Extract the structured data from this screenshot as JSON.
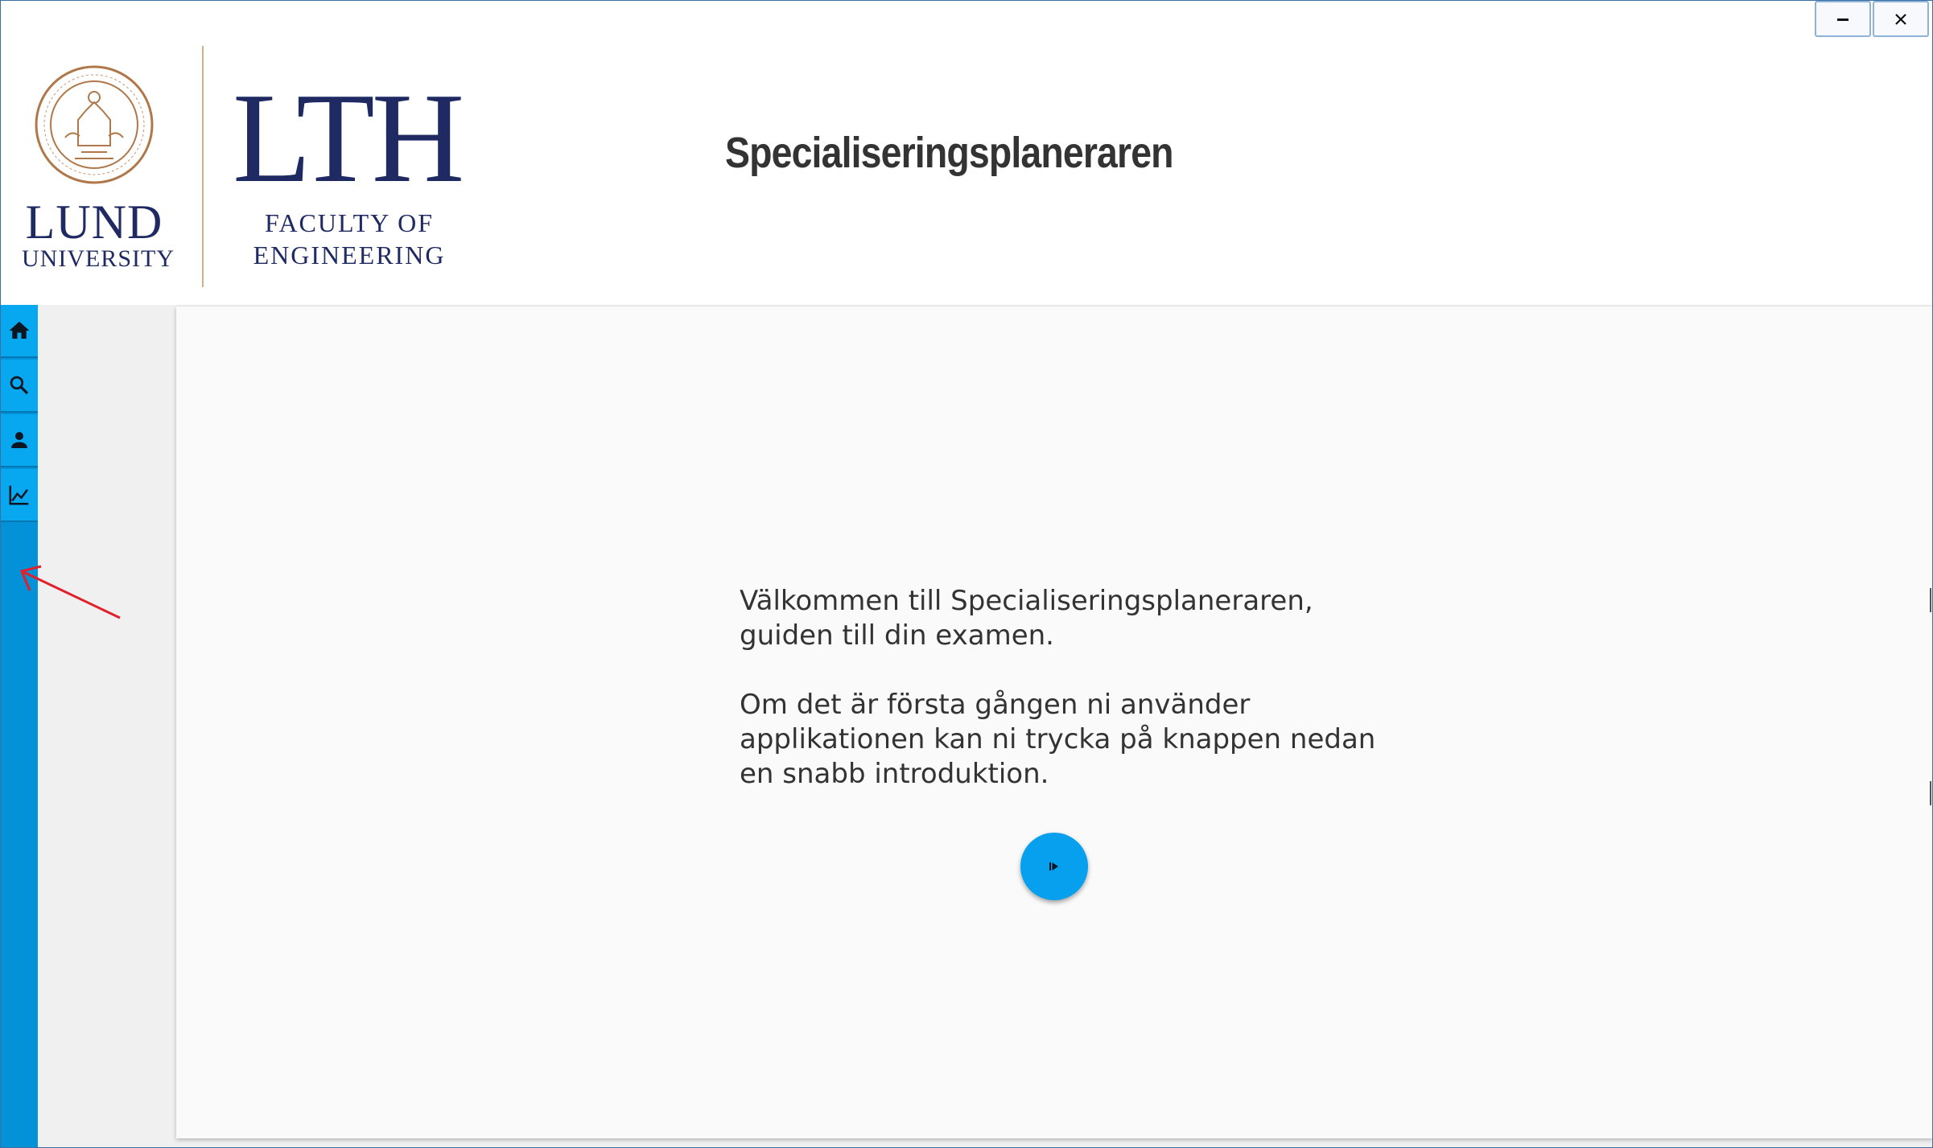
{
  "window": {
    "controls": [
      {
        "name": "minimize",
        "icon": "minimize-icon"
      },
      {
        "name": "close",
        "icon": "close-icon"
      }
    ]
  },
  "header": {
    "lund_logo": {
      "name": "LUND",
      "sub": "UNIVERSITY",
      "seal_icon": "lund-university-seal"
    },
    "lth_logo": {
      "name": "LTH",
      "line1": "FACULTY OF",
      "line2": "ENGINEERING"
    },
    "title": "Specialiseringsplaneraren"
  },
  "sidebar": {
    "items": [
      {
        "name": "home",
        "icon": "home-icon"
      },
      {
        "name": "search",
        "icon": "search-icon"
      },
      {
        "name": "profile",
        "icon": "person-icon"
      },
      {
        "name": "statistics",
        "icon": "line-chart-icon"
      }
    ]
  },
  "main": {
    "welcome_line1": "Välkommen till Specialiseringsplaneraren, guiden till din examen.",
    "welcome_line2": "Om det är första gången ni använder applikationen kan ni trycka på knappen nedan en snabb introduktion.",
    "intro_button_icon": "play-step-icon"
  },
  "colors": {
    "sidebar": "#0392d8",
    "nav_button": "#07a8f0",
    "accent_button": "#07a0ee",
    "logo_blue": "#1f2a63",
    "seal_gold": "#b0784a",
    "annotation_red": "#e0202a"
  }
}
